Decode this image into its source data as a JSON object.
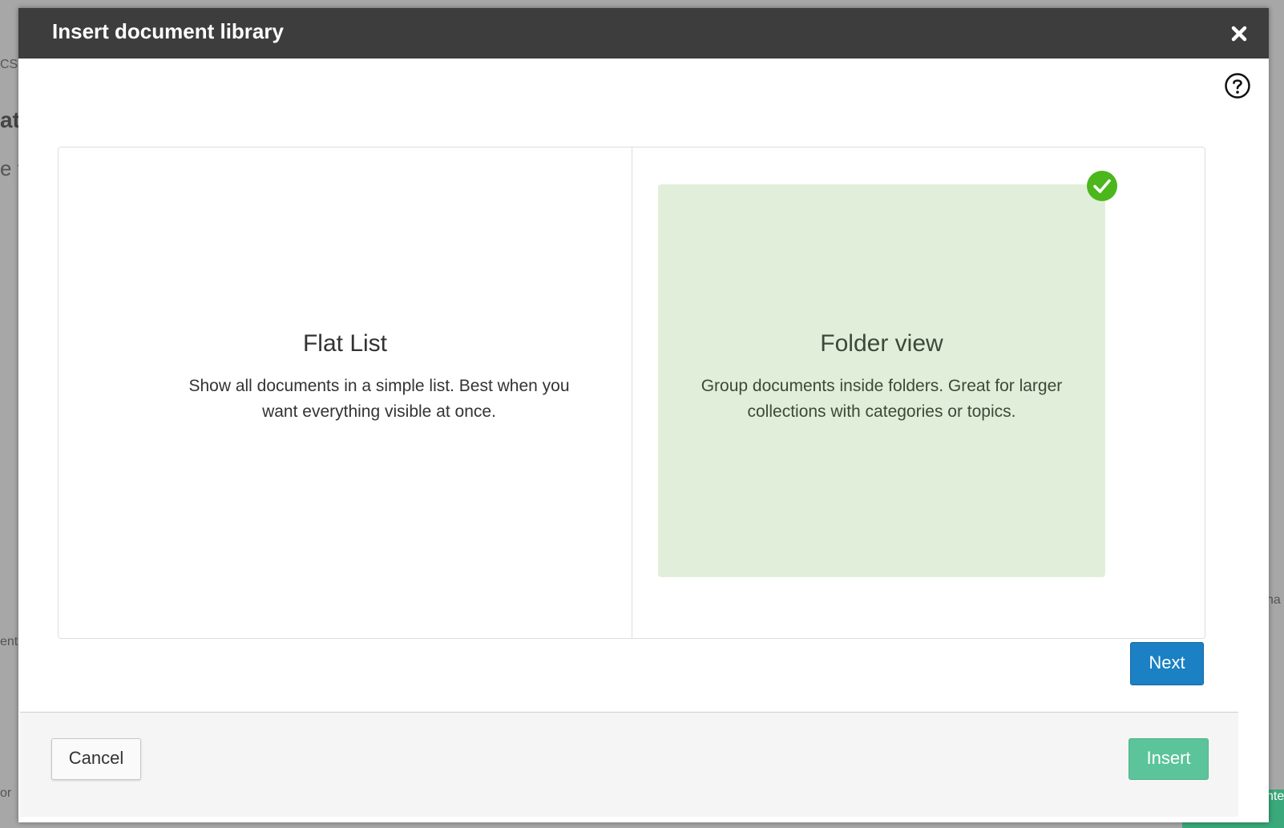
{
  "background": {
    "fragments": [
      "CS",
      "at",
      "e f",
      "ent",
      "or",
      "ha",
      "nte"
    ]
  },
  "dialog": {
    "title": "Insert document library",
    "close_icon": "close-icon",
    "help_icon": "help-circle-icon"
  },
  "options": [
    {
      "title": "Flat List",
      "description": "Show all documents in a simple list. Best when you want everything visible at once.",
      "selected": false
    },
    {
      "title": "Folder view",
      "description": "Group documents inside folders. Great for larger collections with categories or topics.",
      "selected": true,
      "badge_icon": "checkmark-icon",
      "highlight_color": "#e1efda",
      "badge_color": "#4cb61d"
    }
  ],
  "buttons": {
    "next_label": "Next",
    "cancel_label": "Cancel",
    "insert_label": "Insert"
  },
  "colors": {
    "header_bg": "#3d3d3d",
    "primary": "#1b80c4",
    "success": "#5cc49a"
  }
}
